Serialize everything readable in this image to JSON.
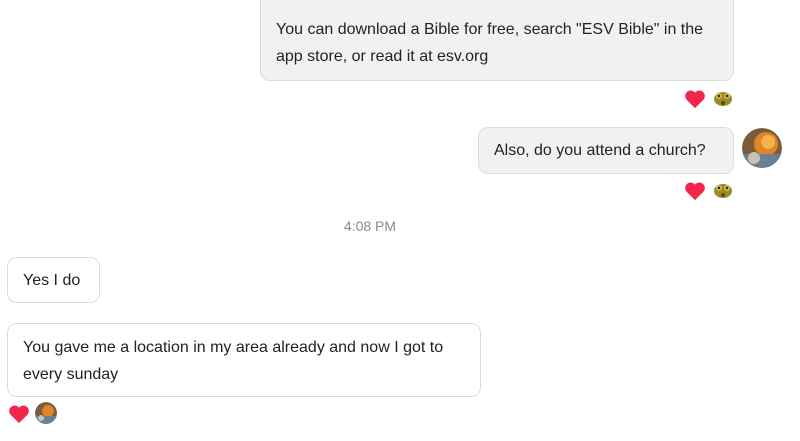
{
  "messages": [
    {
      "id": "m1",
      "direction": "outgoing",
      "text": "You can download a Bible for free, search \"ESV Bible\" in the app store, or read it at esv.org",
      "reactions": [
        "heart-icon",
        "reactor-avatar"
      ]
    },
    {
      "id": "m2",
      "direction": "outgoing",
      "text": "Also, do you attend a church?",
      "reactions": [
        "heart-icon",
        "reactor-avatar"
      ]
    },
    {
      "id": "m3",
      "direction": "incoming",
      "text": "Yes I do"
    },
    {
      "id": "m4",
      "direction": "incoming",
      "text": "You gave me a location in my area already and now I got to every sunday",
      "reactions": [
        "heart-icon",
        "reactor-avatar"
      ]
    }
  ],
  "timestamp": "4:08 PM",
  "colors": {
    "heart": "#f0264b",
    "bubble_out": "#f1f1f1",
    "bubble_border": "#dcdcdc",
    "timestamp": "#8a8a8a"
  }
}
